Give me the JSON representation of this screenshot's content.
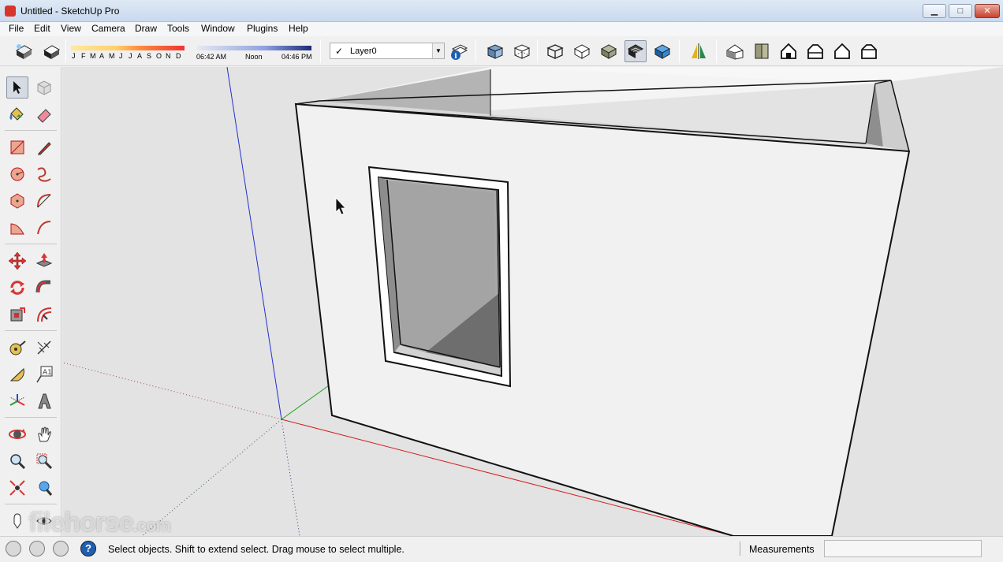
{
  "window": {
    "title": "Untitled - SketchUp Pro",
    "minimize": "▁",
    "maximize": "□",
    "close": "✕"
  },
  "menu": [
    "File",
    "Edit",
    "View",
    "Camera",
    "Draw",
    "Tools",
    "Window",
    "Plugins",
    "Help"
  ],
  "shadows": {
    "months": [
      "J",
      "F",
      "M",
      "A",
      "M",
      "J",
      "J",
      "A",
      "S",
      "O",
      "N",
      "D"
    ],
    "time_start": "06:42 AM",
    "time_mid": "Noon",
    "time_end": "04:46 PM"
  },
  "layers": {
    "current": "Layer0",
    "check": "✓"
  },
  "status": {
    "message": "Select objects. Shift to extend select. Drag mouse to select multiple.",
    "measurements_label": "Measurements",
    "measurements_value": ""
  },
  "watermark": {
    "text": "filehorse",
    "suffix": ".com"
  }
}
